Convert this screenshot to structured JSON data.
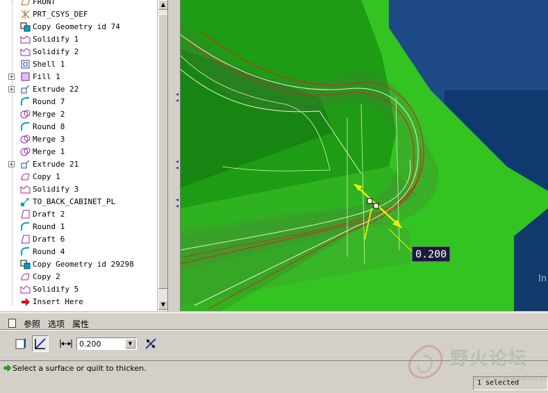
{
  "model_tree": {
    "items": [
      {
        "label": "FRONT",
        "icon": "datum-plane-icon",
        "expandable": false
      },
      {
        "label": "PRT_CSYS_DEF",
        "icon": "csys-icon",
        "expandable": false
      },
      {
        "label": "Copy Geometry id 74",
        "icon": "copy-geometry-icon",
        "expandable": false
      },
      {
        "label": "Solidify 1",
        "icon": "solidify-icon",
        "expandable": false
      },
      {
        "label": "Solidify 2",
        "icon": "solidify-icon",
        "expandable": false
      },
      {
        "label": "Shell 1",
        "icon": "shell-icon",
        "expandable": false
      },
      {
        "label": "Fill 1",
        "icon": "fill-icon",
        "expandable": true
      },
      {
        "label": "Extrude 22",
        "icon": "extrude-icon",
        "expandable": true
      },
      {
        "label": "Round 7",
        "icon": "round-icon",
        "expandable": false
      },
      {
        "label": "Merge 2",
        "icon": "merge-icon",
        "expandable": false
      },
      {
        "label": "Round 8",
        "icon": "round-icon",
        "expandable": false
      },
      {
        "label": "Merge 3",
        "icon": "merge-icon",
        "expandable": false
      },
      {
        "label": "Merge 1",
        "icon": "merge-icon",
        "expandable": false
      },
      {
        "label": "Extrude 21",
        "icon": "extrude-icon",
        "expandable": true
      },
      {
        "label": "Copy 1",
        "icon": "copy-icon",
        "expandable": false
      },
      {
        "label": "Solidify 3",
        "icon": "solidify-icon",
        "expandable": false
      },
      {
        "label": "TO_BACK_CABINET_PL",
        "icon": "transform-icon",
        "expandable": false
      },
      {
        "label": "Draft 2",
        "icon": "draft-icon",
        "expandable": false
      },
      {
        "label": "Round 1",
        "icon": "round-icon",
        "expandable": false
      },
      {
        "label": "Draft 6",
        "icon": "draft-icon",
        "expandable": false
      },
      {
        "label": "Round 4",
        "icon": "round-icon",
        "expandable": false
      },
      {
        "label": "Copy Geometry id 29298",
        "icon": "copy-geometry-icon",
        "expandable": false
      },
      {
        "label": "Copy 2",
        "icon": "copy-icon",
        "expandable": false
      },
      {
        "label": "Solidify 5",
        "icon": "solidify-icon",
        "expandable": false
      },
      {
        "label": "Insert Here",
        "icon": "insert-here-arrow-icon",
        "expandable": false
      }
    ]
  },
  "viewport": {
    "dimension_value": "0.200",
    "edge_text": "In"
  },
  "dashboard": {
    "tabs": [
      "参照",
      "选项",
      "属性"
    ],
    "thickness_value": "0.200"
  },
  "status": {
    "message": "Select a surface or quilt to thicken.",
    "selected": "1 selected"
  },
  "watermark": {
    "text": "野火论坛",
    "url": "www.proewildfire.cn"
  },
  "colors": {
    "model_green": "#2fbf1f",
    "background_blue": "#1e4a86",
    "curve_red": "#c83020",
    "arrow_yellow": "#f0f000"
  }
}
